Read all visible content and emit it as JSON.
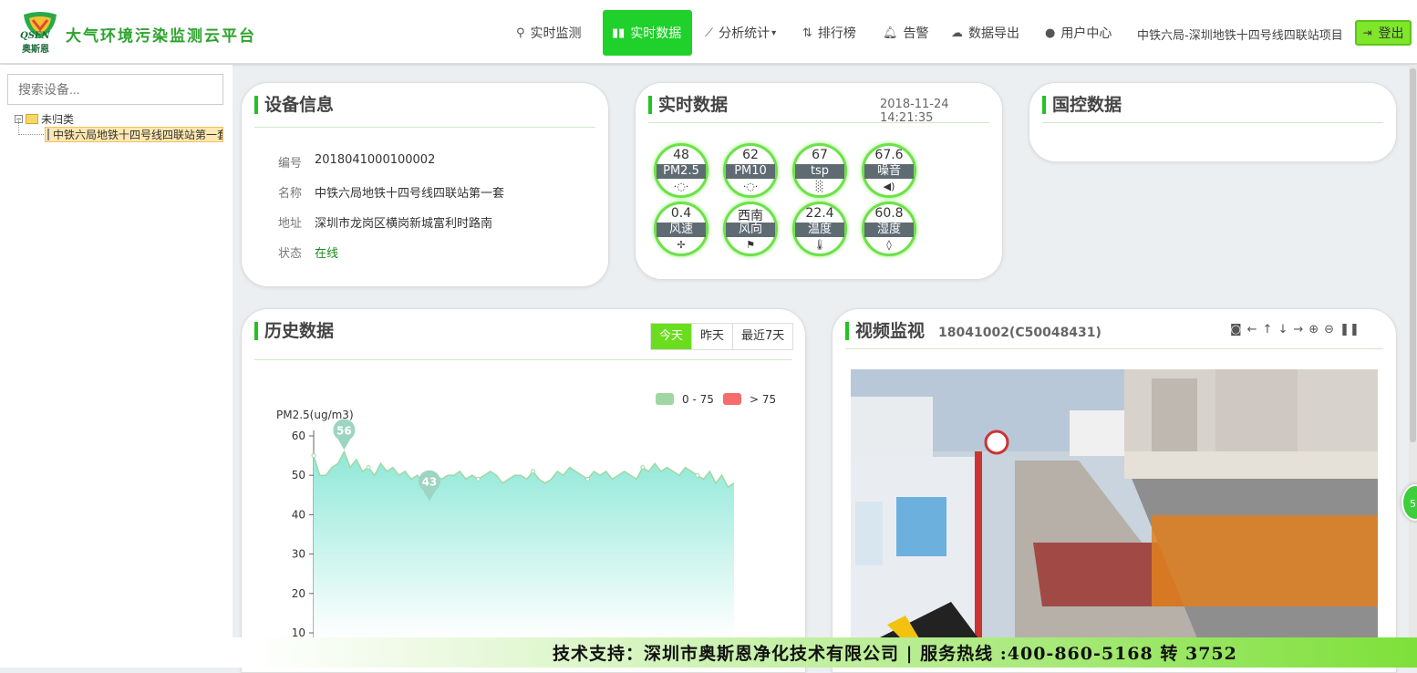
{
  "brand": {
    "logo_en": "QSEN",
    "logo_cn": "奥斯恩",
    "title": "大气环境污染监测云平台"
  },
  "nav": [
    {
      "label": "实时监测",
      "icon": "map-marker-icon"
    },
    {
      "label": "实时数据",
      "icon": "bar-chart-icon",
      "active": true
    },
    {
      "label": "分析统计",
      "icon": "line-chart-icon",
      "dropdown": true
    },
    {
      "label": "排行榜",
      "icon": "sort-icon"
    },
    {
      "label": "告警",
      "icon": "bell-icon"
    },
    {
      "label": "数据导出",
      "icon": "cloud-download-icon"
    },
    {
      "label": "用户中心",
      "icon": "user-icon"
    }
  ],
  "nav_dropdown_caret": "▾",
  "project": "中铁六局-深圳地铁十四号线四联站项目",
  "logout": "登出",
  "sidebar": {
    "search_placeholder": "搜索设备...",
    "tree": {
      "toggle": "⊟",
      "folder": "未归类",
      "leaf": "中铁六局地铁十四号线四联站第一套"
    }
  },
  "device": {
    "title": "设备信息",
    "rows": [
      {
        "label": "编号",
        "value": "2018041000100002"
      },
      {
        "label": "名称",
        "value": "中铁六局地铁十四号线四联站第一套"
      },
      {
        "label": "地址",
        "value": "深圳市龙岗区横岗新城富利时路南"
      },
      {
        "label": "状态",
        "value": "在线"
      }
    ],
    "status_color": "#1a8c1a"
  },
  "realtime": {
    "title": "实时数据",
    "time": "2018-11-24 14:21:35",
    "gauges": [
      {
        "value": "48",
        "label": "PM2.5",
        "icon": "particle-icon",
        "glyph": "·◌·"
      },
      {
        "value": "62",
        "label": "PM10",
        "icon": "particle-icon",
        "glyph": "·◌·"
      },
      {
        "value": "67",
        "label": "tsp",
        "icon": "dust-icon",
        "glyph": "░"
      },
      {
        "value": "67.6",
        "label": "噪音",
        "icon": "horn-icon",
        "glyph": "◀)"
      },
      {
        "value": "0.4",
        "label": "风速",
        "icon": "fan-icon",
        "glyph": "✢"
      },
      {
        "value": "西南",
        "label": "风向",
        "icon": "windsock-icon",
        "glyph": "⚑"
      },
      {
        "value": "22.4",
        "label": "温度",
        "icon": "thermometer-icon",
        "glyph": "🌡"
      },
      {
        "value": "60.8",
        "label": "湿度",
        "icon": "droplet-icon",
        "glyph": "◊"
      }
    ]
  },
  "national": {
    "title": "国控数据"
  },
  "history": {
    "title": "历史数据",
    "tabs": [
      "今天",
      "昨天",
      "最近7天"
    ],
    "selected_tab": 0
  },
  "chart_data": {
    "type": "area",
    "ylabel": "PM2.5(ug/m3)",
    "ylim": [
      10,
      60
    ],
    "yticks": [
      60,
      50,
      40,
      30,
      20,
      10
    ],
    "legend": [
      {
        "label": "0 - 75",
        "color": "#a0d6a4"
      },
      {
        "label": "> 75",
        "color": "#f56c6c"
      }
    ],
    "markers": [
      {
        "label": "56",
        "value": 56,
        "index": 5
      },
      {
        "label": "43",
        "value": 43,
        "index": 19
      }
    ],
    "values": [
      55,
      50,
      50,
      52,
      53,
      56,
      52,
      54,
      51,
      52,
      50,
      53,
      51,
      52,
      50,
      51,
      49,
      50,
      48,
      48,
      50,
      49,
      50,
      50,
      51,
      49,
      50,
      49,
      50,
      51,
      50,
      48,
      49,
      50,
      50,
      49,
      51,
      49,
      48,
      49,
      51,
      50,
      52,
      51,
      50,
      49,
      51,
      50,
      51,
      49,
      50,
      51,
      50,
      49,
      52,
      51,
      53,
      51,
      52,
      51,
      50,
      52,
      51,
      50,
      49,
      51,
      48,
      50,
      47,
      48
    ],
    "series_color": "#8fe8d8"
  },
  "video": {
    "title": "视频监视",
    "device": "18041002(C50048431)",
    "tools": [
      "camera-icon",
      "arrow-left-icon",
      "arrow-up-icon",
      "arrow-down-icon",
      "arrow-right-icon",
      "zoom-in-icon",
      "zoom-out-icon",
      "pause-icon"
    ]
  },
  "footer": "技术支持：深圳市奥斯恩净化技术有限公司 | 服务热线 :400-860-5168 转 3752",
  "float_badge": "5"
}
